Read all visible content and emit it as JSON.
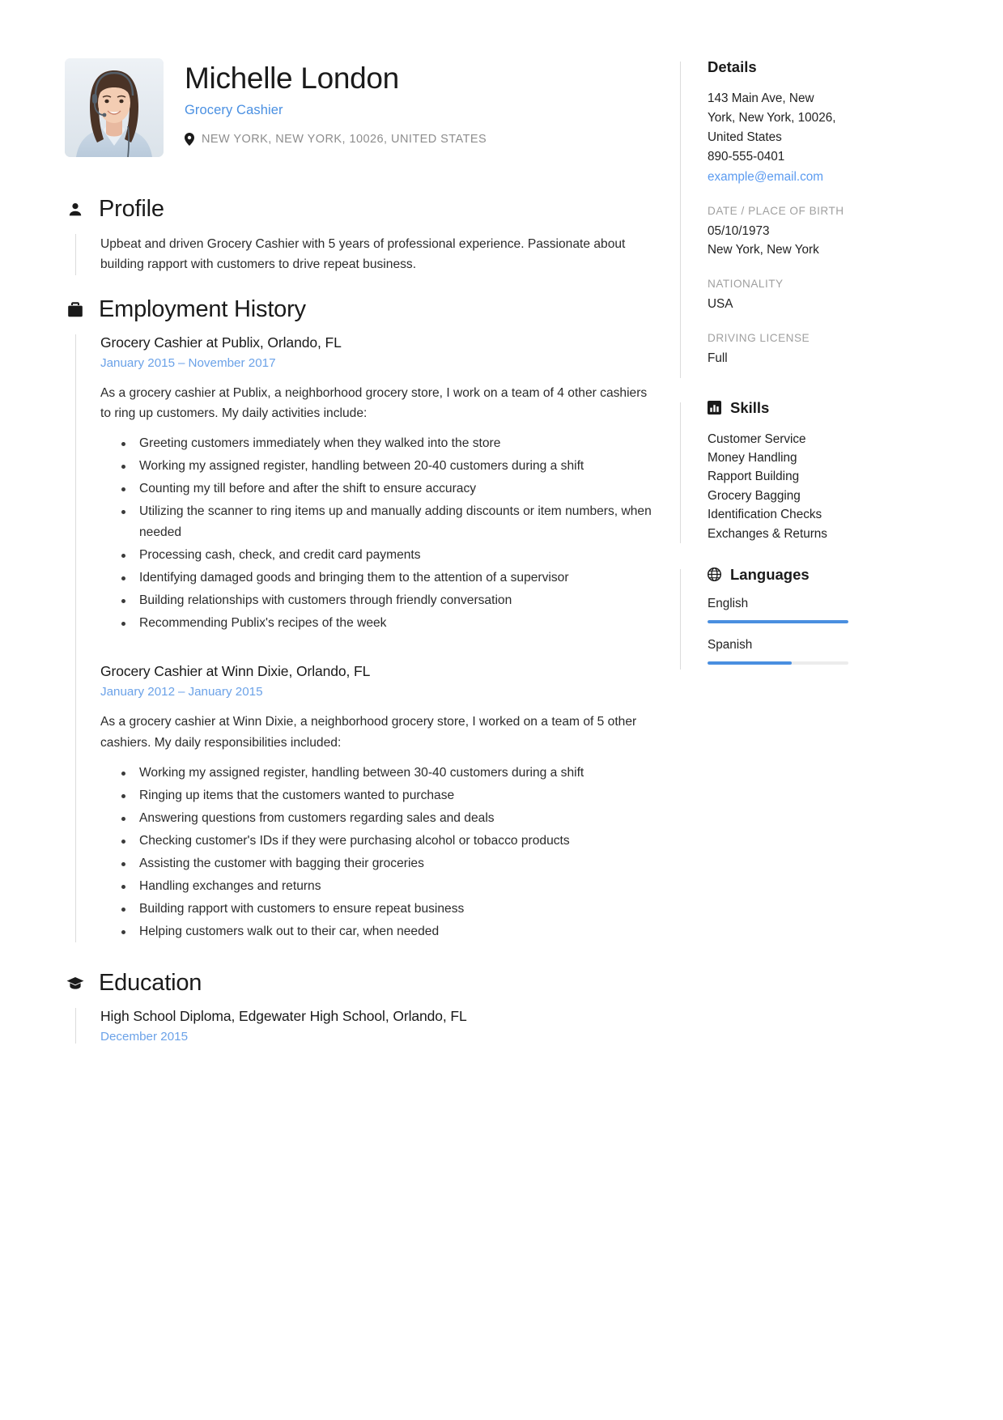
{
  "header": {
    "full_name": "Michelle London",
    "job_title": "Grocery Cashier",
    "location": "NEW YORK, NEW YORK, 10026, UNITED STATES",
    "pin_icon": "location-pin-icon",
    "photo_alt": "profile-photo"
  },
  "profile": {
    "icon": "person-icon",
    "title": "Profile",
    "text": "Upbeat and driven Grocery Cashier with 5 years of professional experience. Passionate about building rapport with customers to drive repeat business."
  },
  "employment": {
    "icon": "briefcase-icon",
    "title": "Employment History",
    "entries": [
      {
        "title": "Grocery Cashier at Publix, Orlando, FL",
        "date_start": "January 2015",
        "date_dash": "–",
        "date_end": "November 2017",
        "intro": "As a grocery cashier at Publix, a neighborhood grocery store, I work on a team of 4 other cashiers to ring up customers. My daily activities include:",
        "bullets": [
          "Greeting customers immediately when they walked into the store",
          "Working my assigned register, handling between 20-40 customers during a shift",
          "Counting my till before and after the shift to ensure accuracy",
          "Utilizing the scanner to ring items up and manually adding discounts or item numbers, when needed",
          "Processing cash, check, and credit card payments",
          "Identifying damaged goods and bringing them to the attention of a supervisor",
          "Building relationships with customers through friendly conversation",
          "Recommending Publix's recipes of the week"
        ]
      },
      {
        "title": "Grocery Cashier at Winn Dixie, Orlando, FL",
        "date_start": "January 2012",
        "date_dash": "–",
        "date_end": "January 2015",
        "intro": "As a grocery cashier at Winn Dixie, a neighborhood grocery store, I worked on a team of 5 other cashiers. My daily responsibilities included:",
        "bullets": [
          "Working my assigned register, handling between 30-40 customers during a shift",
          "Ringing up items that the customers wanted to purchase",
          "Answering questions from customers regarding sales and deals",
          "Checking customer's IDs if they were purchasing alcohol or tobacco products",
          "Assisting the customer with bagging their groceries",
          "Handling exchanges and returns",
          "Building rapport with customers to ensure repeat business",
          "Helping customers walk out to their car, when needed"
        ]
      }
    ]
  },
  "education": {
    "icon": "graduation-cap-icon",
    "title": "Education",
    "entries": [
      {
        "title": "High School Diploma, Edgewater High School, Orlando, FL",
        "date": "December 2015"
      }
    ]
  },
  "details": {
    "title": "Details",
    "address_line1": "143 Main Ave, New",
    "address_line2": "York, New York, 10026,",
    "address_line3": "United States",
    "phone": "890-555-0401",
    "email": "example@email.com",
    "dob_label": "DATE / PLACE OF BIRTH",
    "dob_date": "05/10/1973",
    "dob_place": "New York, New York",
    "nationality_label": "NATIONALITY",
    "nationality_value": "USA",
    "license_label": "DRIVING LICENSE",
    "license_value": "Full"
  },
  "skills": {
    "icon": "bar-chart-icon",
    "title": "Skills",
    "items": [
      "Customer Service",
      "Money Handling",
      "Rapport Building",
      "Grocery Bagging",
      "Identification Checks",
      "Exchanges & Returns"
    ]
  },
  "languages": {
    "icon": "globe-icon",
    "title": "Languages",
    "items": [
      {
        "name": "English",
        "level": 100
      },
      {
        "name": "Spanish",
        "level": 60
      }
    ]
  },
  "colors": {
    "accent_blue": "#4a90e2",
    "link_blue": "#5b9bf0",
    "bar_blue": "#4a8fe0",
    "muted_gray": "#a0a0a0",
    "rule_gray": "#dcdcdc"
  }
}
